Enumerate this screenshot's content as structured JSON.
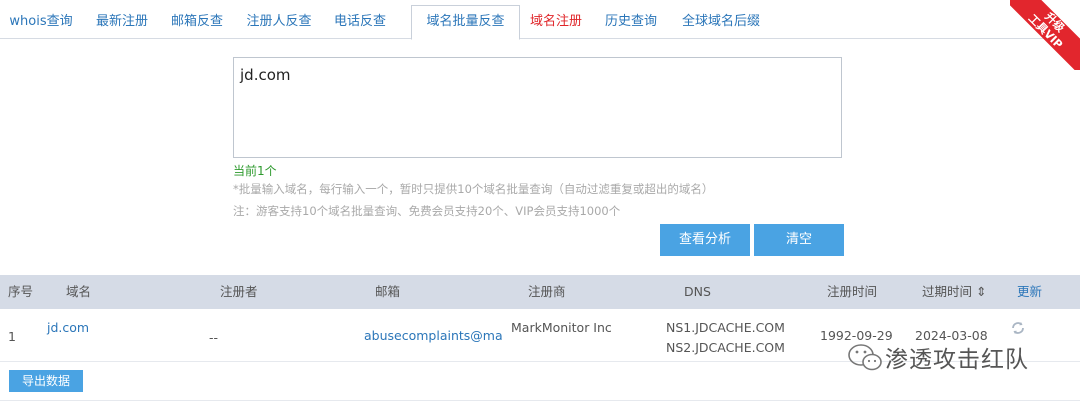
{
  "tabs": [
    {
      "label": "whois查询"
    },
    {
      "label": "最新注册"
    },
    {
      "label": "邮箱反查"
    },
    {
      "label": "注册人反查"
    },
    {
      "label": "电话反查"
    },
    {
      "label": "域名批量反查"
    },
    {
      "label": "域名注册"
    },
    {
      "label": "历史查询"
    },
    {
      "label": "全球域名后缀"
    }
  ],
  "vip_badge": {
    "line1": "升级",
    "line2": "工具VIP"
  },
  "input": {
    "value": "jd.com"
  },
  "count_label": "当前1个",
  "hints": [
    "*批量输入域名，每行输入一个，暂时只提供10个域名批量查询（自动过滤重复或超出的域名）",
    "注：游客支持10个域名批量查询、免费会员支持20个、VIP会员支持1000个"
  ],
  "buttons": {
    "analyze": "查看分析",
    "clear": "清空",
    "export": "导出数据"
  },
  "table": {
    "headers": {
      "index": "序号",
      "domain": "域名",
      "registrant": "注册者",
      "email": "邮箱",
      "registrar": "注册商",
      "dns": "DNS",
      "created": "注册时间",
      "expires": "过期时间 ⇕",
      "update": "更新"
    },
    "rows": [
      {
        "index": "1",
        "domain": "jd.com",
        "registrant": "--",
        "email": "abusecomplaints@ma",
        "registrar": "MarkMonitor Inc",
        "dns1": "NS1.JDCACHE.COM",
        "dns2": "NS2.JDCACHE.COM",
        "created": "1992-09-29",
        "expires": "2024-03-08"
      }
    ]
  },
  "watermark": "渗透攻击红队"
}
